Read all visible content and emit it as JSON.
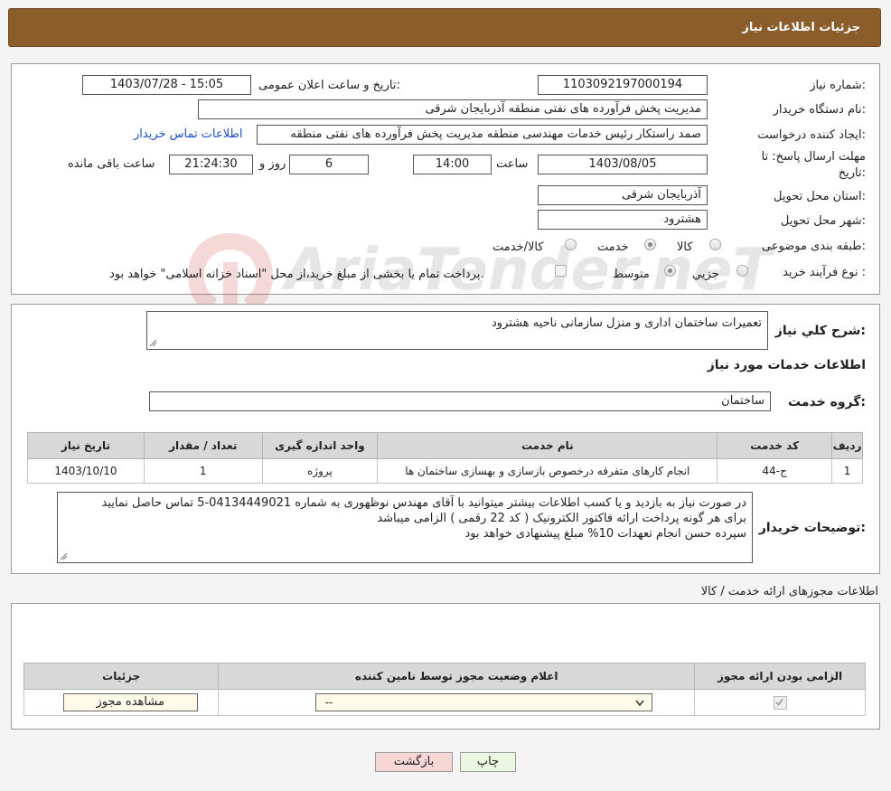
{
  "header": {
    "title": "جزئیات اطلاعات نیاز"
  },
  "info": {
    "need_number_label": "شماره نیاز:",
    "need_number": "1103092197000194",
    "announce_label": "تاریخ و ساعت اعلان عمومی:",
    "announce_value": "1403/07/28 - 15:05",
    "buyer_org_label": "نام دستگاه خریدار:",
    "buyer_org": "مدیریت پخش فرآورده های نفتی منطقه آذربایجان شرقی",
    "requester_label": "ایجاد کننده درخواست:",
    "requester": "صمد راستکار رئیس خدمات مهندسی منطقه مدیریت پخش فرآورده های نفتی منطقه",
    "buyer_contact_link": "اطلاعات تماس خریدار",
    "deadline_label_1": "مهلت ارسال پاسخ: تا",
    "deadline_label_2": "تاریخ:",
    "deadline_date": "1403/08/05",
    "hour_label": "ساعت",
    "deadline_hour": "14:00",
    "days_value": "6",
    "days_label": "روز و",
    "remaining_time": "21:24:30",
    "remaining_label": "ساعت باقی مانده",
    "province_label": "استان محل تحویل:",
    "province": "آذربایجان شرقی",
    "city_label": "شهر محل تحویل:",
    "city": "هشترود",
    "category_label": "طبقه بندی موضوعی:",
    "category_options": [
      "کالا",
      "خدمت",
      "کالا/خدمت"
    ],
    "process_label": "نوع فرآیند خرید :",
    "process_options": [
      "جزیي",
      "متوسط"
    ],
    "process_note": "پرداخت تمام یا بخشی از مبلغ خرید،از محل \"اسناد خزانه اسلامی\" خواهد بود."
  },
  "description": {
    "label": "شرح کلي نیاز:",
    "value": "تعمیرات ساختمان اداری و منزل سازمانی ناحیه هشترود"
  },
  "services": {
    "section_title": "اطلاعات خدمات مورد نیاز",
    "group_label": "گروه خدمت:",
    "group_value": "ساختمان",
    "columns": [
      "ردیف",
      "کد خدمت",
      "نام خدمت",
      "واحد اندازه گیری",
      "تعداد / مقدار",
      "تاریخ نیاز"
    ],
    "rows": [
      [
        "1",
        "ج-44",
        "انجام کارهای متفرقه درخصوص بازسازی و بهسازی ساختمان ها",
        "پروژه",
        "1",
        "1403/10/10"
      ]
    ]
  },
  "buyer_notes": {
    "label": "توضیحات خریدار:",
    "lines": [
      "در صورت نیاز به بازدید و یا کسب اطلاعات بیشتر میتوانید با آقای مهندس نوظهوری به شماره  04134449021-5 تماس حاصل نمایید",
      "برای هر گونه پرداخت ارائه فاکتور الکترونیک ( کد 22 رقمی ) الزامی میباشد",
      "سپرده حسن انجام تعهدات  10%  مبلغ پیشنهادی خواهد بود"
    ]
  },
  "permits": {
    "title": "اطلاعات مجوزهای ارائه خدمت / کالا",
    "columns": [
      "الزامی بودن ارائه مجوز",
      "اعلام وضعیت مجوز توسط نامین کننده",
      "جزئیات"
    ],
    "select_value": "--",
    "view_button": "مشاهده مجوز"
  },
  "footer": {
    "print": "چاپ",
    "back": "بازگشت"
  },
  "watermark": {
    "text": "AriaTender.neT"
  },
  "colors": {
    "header": "#8a5d2a",
    "link": "#1a4fc9",
    "back_btn": "#f7d6d6",
    "print_btn": "#e9f7e0"
  }
}
